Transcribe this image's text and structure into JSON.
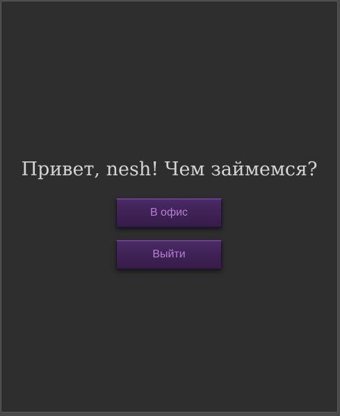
{
  "greeting": {
    "text": "Привет, nesh! Чем займемся?"
  },
  "actions": {
    "office_label": "В офис",
    "exit_label": "Выйти"
  },
  "colors": {
    "background": "#2e2e2e",
    "text": "#d4d4d4",
    "button_bg": "#3f2256",
    "button_text": "#b77fd6"
  }
}
